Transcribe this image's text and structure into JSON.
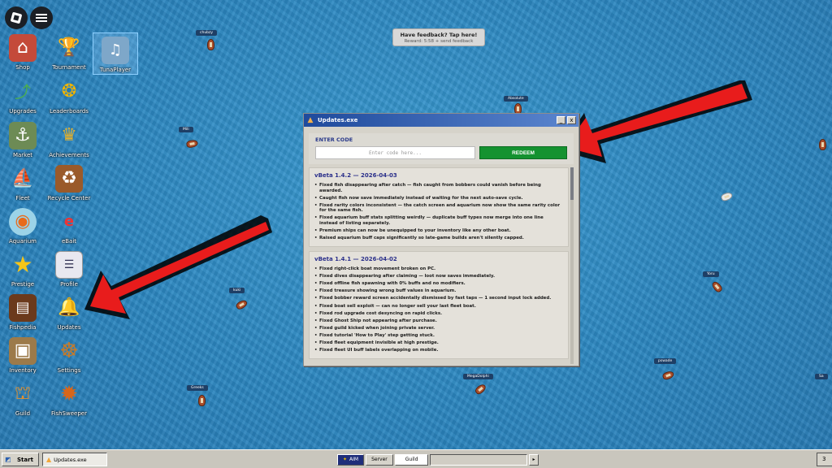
{
  "topbar": {
    "logo_icon": "roblox-logo-icon",
    "menu_icon": "hamburger-menu-icon"
  },
  "desktop_icons": [
    {
      "label": "Shop",
      "icon": "shop-icon"
    },
    {
      "label": "Tournament",
      "icon": "trophy-icon"
    },
    {
      "label": "TunaPlayer",
      "icon": "tuna-player-icon"
    },
    {
      "label": "Upgrades",
      "icon": "fishing-rod-icon"
    },
    {
      "label": "Leaderboards",
      "icon": "medal-icon"
    },
    {
      "label": "Market",
      "icon": "market-icon"
    },
    {
      "label": "Achievements",
      "icon": "achievement-cup-icon"
    },
    {
      "label": "Fleet",
      "icon": "ship-icon"
    },
    {
      "label": "Recycle Center",
      "icon": "recycle-bin-icon"
    },
    {
      "label": "Aquarium",
      "icon": "aquarium-icon"
    },
    {
      "label": "eBait",
      "icon": "ebait-icon"
    },
    {
      "label": "Prestige",
      "icon": "star-icon"
    },
    {
      "label": "Profile",
      "icon": "profile-card-icon"
    },
    {
      "label": "Fishpedia",
      "icon": "book-icon"
    },
    {
      "label": "Updates",
      "icon": "bell-icon"
    },
    {
      "label": "Inventory",
      "icon": "crate-icon"
    },
    {
      "label": "Settings",
      "icon": "ship-wheel-icon"
    },
    {
      "label": "Guild",
      "icon": "guild-icon"
    },
    {
      "label": "FishSweeper",
      "icon": "sea-mine-icon"
    }
  ],
  "feedback": {
    "title": "Have feedback? Tap here!",
    "subtitle": "Reward: 5:58 + send feedback"
  },
  "players": [
    "chubzy",
    "Absolute",
    "Mili",
    "kuki",
    "Yoru",
    "Greeks",
    "MegaDolphi",
    "pswade",
    "Sa"
  ],
  "window": {
    "title": "Updates.exe",
    "minimize_label": "_",
    "close_label": "x",
    "code_header": "ENTER CODE",
    "code_placeholder": "Enter code here...",
    "redeem_label": "REDEEM",
    "updates": [
      {
        "version": "vBeta 1.4.2  — 2026-04-03",
        "items": [
          "Fixed fish disappearing after catch — fish caught from bobbers could vanish before being awarded.",
          "Caught fish now save immediately instead of waiting for the next auto-save cycle.",
          "Fixed rarity colors inconsistent — the catch screen and aquarium now show the same rarity color for the same fish.",
          "Fixed aquarium buff stats splitting weirdly — duplicate buff types now merge into one line instead of listing separately.",
          "Premium ships can now be unequipped to your inventory like any other boat.",
          "Raised aquarium buff caps significantly so late-game builds aren't silently capped."
        ]
      },
      {
        "version": "vBeta 1.4.1  — 2026-04-02",
        "items": [
          "Fixed right-click boat movement broken on PC.",
          "Fixed dives disappearing after claiming — loot now saves immediately.",
          "Fixed offline fish spawning with 0% buffs and no modifiers.",
          "Fixed treasure showing wrong buff values in aquarium.",
          "Fixed bobber reward screen accidentally dismissed by fast taps — 1 second input lock added.",
          "Fixed boat sell exploit — can no longer sell your last fleet boat.",
          "Fixed rod upgrade cost desyncing on rapid clicks.",
          "Fixed Ghost Ship not appearing after purchase.",
          "Fixed guild kicked when joining private server.",
          "Fixed tutorial 'How to Play' step getting stuck.",
          "Fixed fleet equipment invisible at high prestige.",
          "Fixed fleet UI buff labels overlapping on mobile."
        ]
      }
    ]
  },
  "taskbar": {
    "start_label": "Start",
    "task_label": "Updates.exe",
    "tabs": [
      "AIM",
      "Server",
      "Guild"
    ],
    "right_label": "3"
  },
  "colors": {
    "ocean": "#2b86c0",
    "redeem": "#149230",
    "titlebar": "#1f4a9c",
    "arrow": "#e81c1c"
  }
}
